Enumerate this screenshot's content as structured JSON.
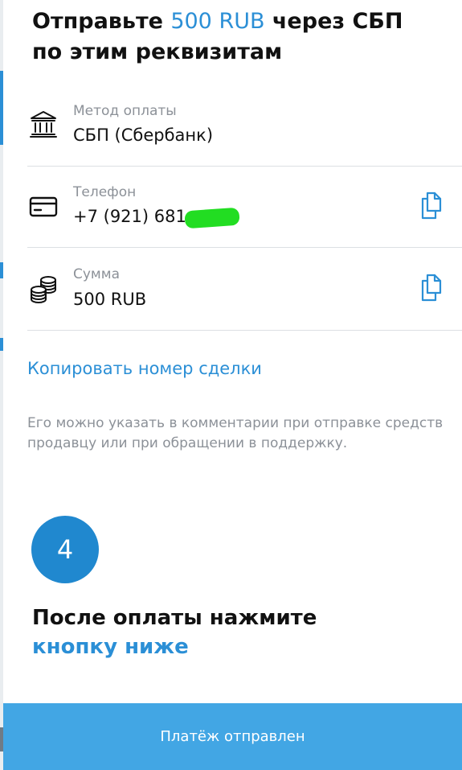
{
  "header": {
    "title_start": "Отправьте ",
    "title_amount": "500 RUB",
    "title_mid": " через СБП",
    "title_end": "по этим реквизитам"
  },
  "details": {
    "method": {
      "label": "Метод оплаты",
      "value": "СБП (Сбербанк)",
      "icon": "bank-icon"
    },
    "phone": {
      "label": "Телефон",
      "value": "+7 (921) 681-",
      "icon": "card-icon",
      "copy_icon": "copy-icon"
    },
    "amount": {
      "label": "Сумма",
      "value": "500 RUB",
      "icon": "coins-icon",
      "copy_icon": "copy-icon"
    }
  },
  "deal": {
    "copy_link": "Копировать номер сделки",
    "note": "Его можно указать в комментарии при отправке средств продавцу или при обращении в поддержку."
  },
  "step": {
    "number": "4",
    "title_line1": "После оплаты нажмите",
    "title_line2": "кнопку ниже"
  },
  "submit_label": "Платёж отправлен",
  "colors": {
    "accent": "#2b8fd6",
    "button": "#42a6e4",
    "step_circle": "#2088cf",
    "muted_text": "#8c9198"
  }
}
